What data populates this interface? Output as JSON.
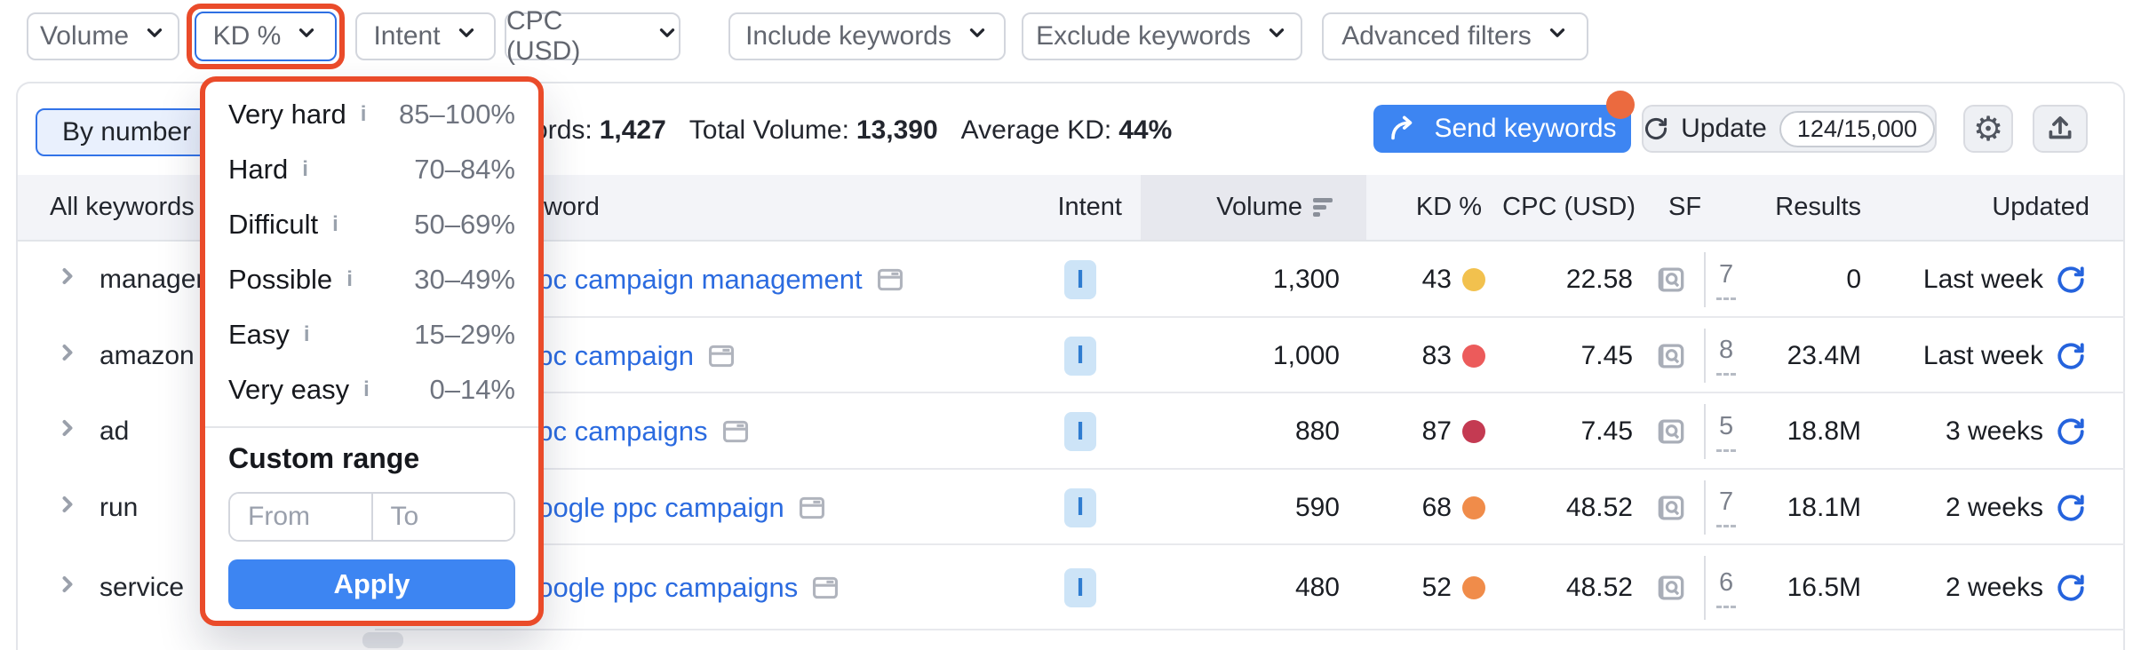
{
  "filter_bar": {
    "filters": [
      {
        "label": "Volume"
      },
      {
        "label": "KD %",
        "highlighted": true
      },
      {
        "label": "Intent"
      },
      {
        "label": "CPC (USD)"
      },
      {
        "label": "Include keywords"
      },
      {
        "label": "Exclude keywords"
      },
      {
        "label": "Advanced filters"
      }
    ]
  },
  "kd_dropdown": {
    "options": [
      {
        "label": "Very hard",
        "range": "85–100%"
      },
      {
        "label": "Hard",
        "range": "70–84%"
      },
      {
        "label": "Difficult",
        "range": "50–69%"
      },
      {
        "label": "Possible",
        "range": "30–49%"
      },
      {
        "label": "Easy",
        "range": "15–29%"
      },
      {
        "label": "Very easy",
        "range": "0–14%"
      }
    ],
    "custom_range_title": "Custom range",
    "from_placeholder": "From",
    "to_placeholder": "To",
    "apply_label": "Apply",
    "annotation_color": "#ea4b2a"
  },
  "toolbar": {
    "by_number_label": "By number",
    "stats": [
      {
        "label": "All keywords:",
        "value": "1,427"
      },
      {
        "label": "Total Volume:",
        "value": "13,390"
      },
      {
        "label": "Average KD:",
        "value": "44%"
      }
    ],
    "send_keywords_label": "Send keywords",
    "update_label": "Update",
    "update_quota": "124/15,000",
    "accent_blue": "#3d85f2",
    "notification_dot_color": "#eb6a3f"
  },
  "sidebar": {
    "header": "All keywords",
    "groups": [
      "management",
      "amazon",
      "ad",
      "run",
      "service"
    ]
  },
  "table": {
    "columns": {
      "keyword": "Keyword",
      "intent": "Intent",
      "volume": "Volume",
      "kd": "KD %",
      "cpc": "CPC (USD)",
      "sf": "SF",
      "results": "Results",
      "updated": "Updated"
    },
    "rows": [
      {
        "keyword": "ppc campaign management",
        "intent": "I",
        "volume": "1,300",
        "kd": "43",
        "kd_color": "#f2c14e",
        "cpc": "22.58",
        "sf": "7",
        "results": "0",
        "updated": "Last week"
      },
      {
        "keyword": "ppc campaign",
        "intent": "I",
        "volume": "1,000",
        "kd": "83",
        "kd_color": "#ec5b5b",
        "cpc": "7.45",
        "sf": "8",
        "results": "23.4M",
        "updated": "Last week"
      },
      {
        "keyword": "ppc campaigns",
        "intent": "I",
        "volume": "880",
        "kd": "87",
        "kd_color": "#c43a52",
        "cpc": "7.45",
        "sf": "5",
        "results": "18.8M",
        "updated": "3 weeks"
      },
      {
        "keyword": "google ppc campaign",
        "intent": "I",
        "volume": "590",
        "kd": "68",
        "kd_color": "#f08c4a",
        "cpc": "48.52",
        "sf": "7",
        "results": "18.1M",
        "updated": "2 weeks"
      },
      {
        "keyword": "google ppc campaigns",
        "intent": "I",
        "volume": "480",
        "kd": "52",
        "kd_color": "#f08c4a",
        "cpc": "48.52",
        "sf": "6",
        "results": "16.5M",
        "updated": "2 weeks"
      }
    ],
    "link_color": "#2b6be0",
    "intent_badge_bg": "#cde4f7",
    "intent_badge_text": "#2f7cd0"
  }
}
